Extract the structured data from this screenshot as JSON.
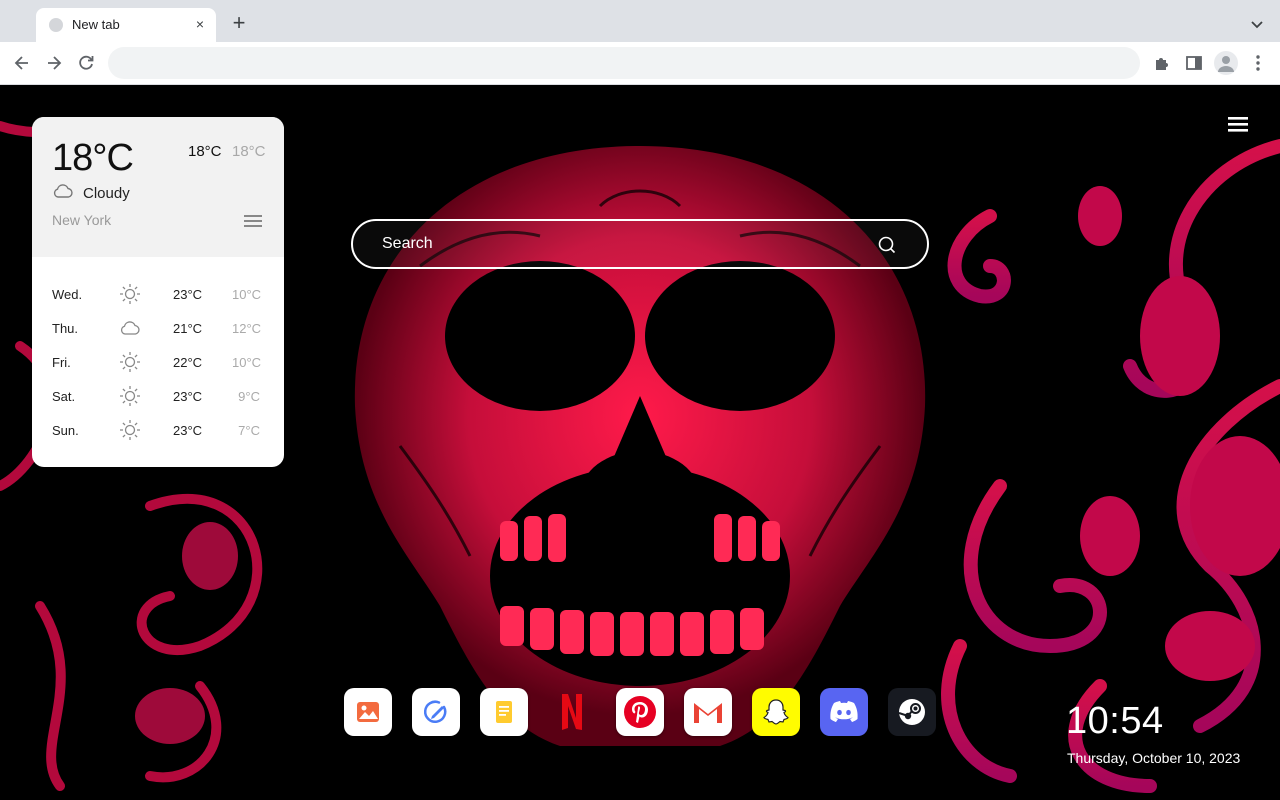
{
  "browser": {
    "tab_title": "New tab",
    "close_symbol": "×",
    "new_tab_symbol": "+",
    "address_value": ""
  },
  "weather": {
    "current_temp": "18°C",
    "high": "18°C",
    "low": "18°C",
    "condition": "Cloudy",
    "condition_icon": "cloud-icon",
    "city": "New York",
    "forecast": [
      {
        "day": "Wed.",
        "icon": "sun-icon",
        "high": "23°C",
        "low": "10°C"
      },
      {
        "day": "Thu.",
        "icon": "cloud-icon",
        "high": "21°C",
        "low": "12°C"
      },
      {
        "day": "Fri.",
        "icon": "sun-icon",
        "high": "22°C",
        "low": "10°C"
      },
      {
        "day": "Sat.",
        "icon": "sun-icon",
        "high": "23°C",
        "low": "9°C"
      },
      {
        "day": "Sun.",
        "icon": "sun-icon",
        "high": "23°C",
        "low": "7°C"
      }
    ]
  },
  "search": {
    "placeholder": "Search"
  },
  "dock": [
    {
      "name": "photos-app",
      "icon": "image-icon",
      "color": "#f0683a"
    },
    {
      "name": "editor-app",
      "icon": "pen-circle-icon",
      "color": "#4a7cf6"
    },
    {
      "name": "notes-app",
      "icon": "note-icon",
      "color": "#f5b700"
    },
    {
      "name": "netflix-app",
      "icon": "netflix-icon",
      "color": "#e50914"
    },
    {
      "name": "pinterest-app",
      "icon": "pinterest-icon",
      "color": "#e60023"
    },
    {
      "name": "gmail-app",
      "icon": "gmail-icon",
      "color": "#ea4335"
    },
    {
      "name": "snapchat-app",
      "icon": "snapchat-icon",
      "color": "#fffc00"
    },
    {
      "name": "discord-app",
      "icon": "discord-icon",
      "color": "#5865f2"
    },
    {
      "name": "steam-app",
      "icon": "steam-icon",
      "color": "#171a21"
    }
  ],
  "clock": {
    "time": "10:54",
    "date": "Thursday, October 10, 2023"
  }
}
